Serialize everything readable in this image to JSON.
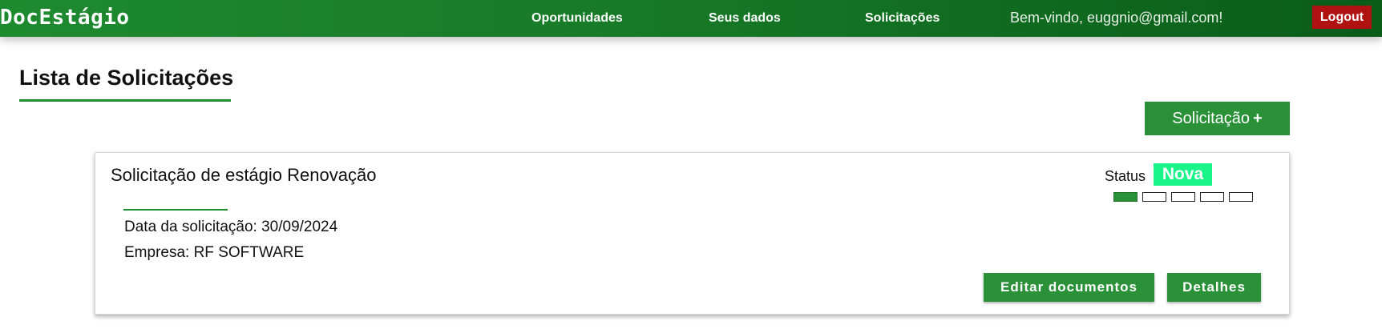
{
  "brand": "DocEstágio",
  "nav": {
    "links": [
      {
        "label": "Oportunidades"
      },
      {
        "label": "Seus dados"
      },
      {
        "label": "Solicitações"
      }
    ],
    "welcome": "Bem-vindo, euggnio@gmail.com!",
    "logout_label": "Logout"
  },
  "colors": {
    "nav_gradient": [
      "#1e8a2e",
      "#0a5c18"
    ],
    "accent": "#2a9138",
    "logout": "#b01212",
    "status_new": "#1af58a"
  },
  "page": {
    "title": "Lista de Solicitações",
    "add_button_label": "Solicitação",
    "add_button_icon": "+"
  },
  "requests": [
    {
      "title": "Solicitação de estágio Renovação",
      "date_line": "Data da solicitação: 30/09/2024",
      "company_line": "Empresa: RF SOFTWARE",
      "status_label": "Status",
      "status_value": "Nova",
      "progress": {
        "completed_steps": 1,
        "total_steps": 5
      },
      "edit_button_label": "Editar documentos",
      "details_button_label": "Detalhes"
    }
  ]
}
